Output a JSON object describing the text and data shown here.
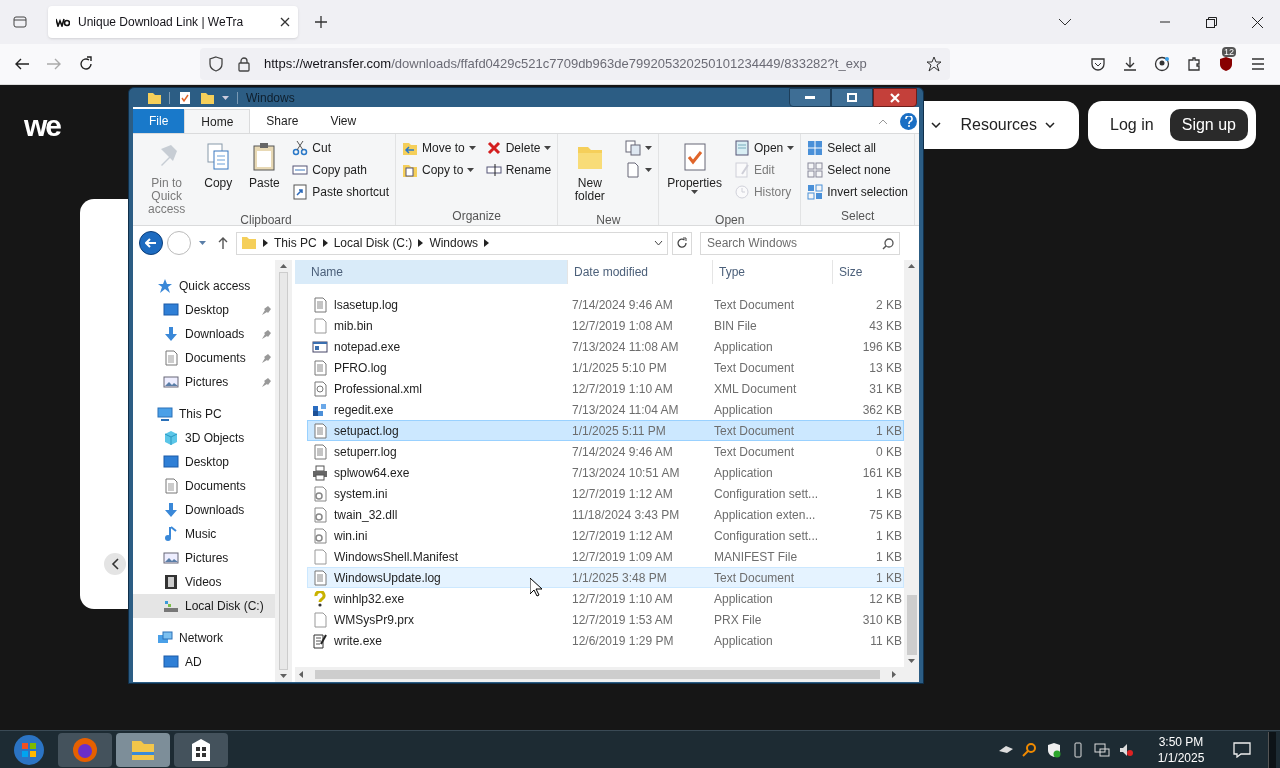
{
  "browser": {
    "tabs": [
      {
        "title": "Unique Download Link | WeTra",
        "selected": true
      }
    ],
    "address": {
      "host": "https://wetransfer.com",
      "path": "/downloads/ffafd0429c521c7709db963de799205320250101234449/833282?t_exp"
    },
    "extension_badge": "12"
  },
  "website": {
    "logo": "we",
    "menus": [
      {
        "label": "Resources"
      }
    ],
    "login": "Log in",
    "signup": "Sign up"
  },
  "explorer": {
    "title": "Windows",
    "ribbon_tabs": [
      {
        "label": "File",
        "kind": "file",
        "selected": false
      },
      {
        "label": "Home",
        "kind": "tab",
        "selected": true
      },
      {
        "label": "Share",
        "kind": "tab",
        "selected": false
      },
      {
        "label": "View",
        "kind": "tab",
        "selected": false
      }
    ],
    "groups": [
      {
        "label": "Clipboard",
        "columns": [
          [
            {
              "label": "Pin to Quick access",
              "kind": "pin",
              "large": true,
              "disabled": true
            }
          ],
          [
            {
              "label": "Copy",
              "kind": "copy",
              "large": true,
              "disabled": false
            }
          ],
          [
            {
              "label": "Paste",
              "kind": "paste",
              "large": true,
              "disabled": false
            }
          ],
          [
            {
              "label": "Cut",
              "kind": "cut",
              "large": false,
              "disabled": false
            },
            {
              "label": "Copy path",
              "kind": "path",
              "large": false,
              "disabled": false
            },
            {
              "label": "Paste shortcut",
              "kind": "shortcut",
              "large": false,
              "disabled": false
            }
          ]
        ]
      },
      {
        "label": "Organize",
        "columns": [
          [
            {
              "label": "Move to",
              "kind": "move",
              "large": false,
              "disabled": false,
              "dropdown": true
            },
            {
              "label": "Copy to",
              "kind": "copyto",
              "large": false,
              "disabled": false,
              "dropdown": true
            }
          ],
          [
            {
              "label": "Delete",
              "kind": "delete",
              "large": false,
              "disabled": false,
              "dropdown": true
            },
            {
              "label": "Rename",
              "kind": "rename",
              "large": false,
              "disabled": false
            }
          ]
        ]
      },
      {
        "label": "New",
        "columns": [
          [
            {
              "label": "New folder",
              "kind": "folder",
              "large": true,
              "disabled": false
            }
          ],
          [
            {
              "kind": "newitem",
              "large": false,
              "disabled": false,
              "dropdown": true
            },
            {
              "kind": "easyaccess",
              "large": false,
              "disabled": false,
              "dropdown": true
            }
          ]
        ]
      },
      {
        "label": "Open",
        "columns": [
          [
            {
              "label": "Properties",
              "kind": "properties",
              "large": true,
              "disabled": false,
              "dropdown": true
            }
          ],
          [
            {
              "label": "Open",
              "kind": "open",
              "large": false,
              "disabled": false,
              "dropdown": true
            },
            {
              "label": "Edit",
              "kind": "edit",
              "large": false,
              "disabled": true
            },
            {
              "label": "History",
              "kind": "history",
              "large": false,
              "disabled": true
            }
          ]
        ]
      },
      {
        "label": "Select",
        "columns": [
          [
            {
              "label": "Select all",
              "kind": "selectall",
              "large": false,
              "disabled": false
            },
            {
              "label": "Select none",
              "kind": "selectnone",
              "large": false,
              "disabled": false
            },
            {
              "label": "Invert selection",
              "kind": "invert",
              "large": false,
              "disabled": false
            }
          ]
        ]
      }
    ],
    "breadcrumbs": [
      "This PC",
      "Local Disk (C:)",
      "Windows"
    ],
    "search": {
      "placeholder": "Search Windows"
    },
    "nav": [
      {
        "label": "Quick access",
        "kind": "star",
        "selected": false,
        "children": [
          {
            "label": "Desktop",
            "kind": "desktop",
            "selected": false,
            "pinned": true
          },
          {
            "label": "Downloads",
            "kind": "downloads",
            "selected": false,
            "pinned": true
          },
          {
            "label": "Documents",
            "kind": "documents",
            "selected": false,
            "pinned": true
          },
          {
            "label": "Pictures",
            "kind": "pictures",
            "selected": false,
            "pinned": true
          }
        ]
      },
      {
        "label": "This PC",
        "kind": "pc",
        "selected": false,
        "children": [
          {
            "label": "3D Objects",
            "kind": "cube",
            "selected": false,
            "pinned": false
          },
          {
            "label": "Desktop",
            "kind": "desktop",
            "selected": false,
            "pinned": false
          },
          {
            "label": "Documents",
            "kind": "documents",
            "selected": false,
            "pinned": false
          },
          {
            "label": "Downloads",
            "kind": "downloads",
            "selected": false,
            "pinned": false
          },
          {
            "label": "Music",
            "kind": "music",
            "selected": false,
            "pinned": false
          },
          {
            "label": "Pictures",
            "kind": "pictures",
            "selected": false,
            "pinned": false
          },
          {
            "label": "Videos",
            "kind": "videos",
            "selected": false,
            "pinned": false
          },
          {
            "label": "Local Disk (C:)",
            "kind": "disk",
            "selected": true,
            "pinned": false
          }
        ]
      },
      {
        "label": "Network",
        "kind": "network",
        "selected": false,
        "children": [
          {
            "label": "AD",
            "kind": "desktop",
            "selected": false,
            "pinned": false
          }
        ]
      }
    ],
    "columns": [
      "Name",
      "Date modified",
      "Type",
      "Size"
    ],
    "files": [
      {
        "name": "lsasetup.log",
        "date": "7/14/2024 9:46 AM",
        "type": "Text Document",
        "size": "2 KB",
        "kind": "text",
        "selected": false,
        "hovered": false
      },
      {
        "name": "mib.bin",
        "date": "12/7/2019 1:08 AM",
        "type": "BIN File",
        "size": "43 KB",
        "kind": "blank",
        "selected": false,
        "hovered": false
      },
      {
        "name": "notepad.exe",
        "date": "7/13/2024 11:08 AM",
        "type": "Application",
        "size": "196 KB",
        "kind": "app",
        "selected": false,
        "hovered": false
      },
      {
        "name": "PFRO.log",
        "date": "1/1/2025 5:10 PM",
        "type": "Text Document",
        "size": "13 KB",
        "kind": "text",
        "selected": false,
        "hovered": false
      },
      {
        "name": "Professional.xml",
        "date": "12/7/2019 1:10 AM",
        "type": "XML Document",
        "size": "31 KB",
        "kind": "xml",
        "selected": false,
        "hovered": false
      },
      {
        "name": "regedit.exe",
        "date": "7/13/2024 11:04 AM",
        "type": "Application",
        "size": "362 KB",
        "kind": "regedit",
        "selected": false,
        "hovered": false
      },
      {
        "name": "setupact.log",
        "date": "1/1/2025 5:11 PM",
        "type": "Text Document",
        "size": "1 KB",
        "kind": "text",
        "selected": true,
        "hovered": false
      },
      {
        "name": "setuperr.log",
        "date": "7/14/2024 9:46 AM",
        "type": "Text Document",
        "size": "0 KB",
        "kind": "text",
        "selected": false,
        "hovered": false
      },
      {
        "name": "splwow64.exe",
        "date": "7/13/2024 10:51 AM",
        "type": "Application",
        "size": "161 KB",
        "kind": "printer",
        "selected": false,
        "hovered": false
      },
      {
        "name": "system.ini",
        "date": "12/7/2019 1:12 AM",
        "type": "Configuration sett...",
        "size": "1 KB",
        "kind": "config",
        "selected": false,
        "hovered": false
      },
      {
        "name": "twain_32.dll",
        "date": "11/18/2024 3:43 PM",
        "type": "Application exten...",
        "size": "75 KB",
        "kind": "config",
        "selected": false,
        "hovered": false
      },
      {
        "name": "win.ini",
        "date": "12/7/2019 1:12 AM",
        "type": "Configuration sett...",
        "size": "1 KB",
        "kind": "config",
        "selected": false,
        "hovered": false
      },
      {
        "name": "WindowsShell.Manifest",
        "date": "12/7/2019 1:09 AM",
        "type": "MANIFEST File",
        "size": "1 KB",
        "kind": "blank",
        "selected": false,
        "hovered": false
      },
      {
        "name": "WindowsUpdate.log",
        "date": "1/1/2025 3:48 PM",
        "type": "Text Document",
        "size": "1 KB",
        "kind": "text",
        "selected": false,
        "hovered": true
      },
      {
        "name": "winhlp32.exe",
        "date": "12/7/2019 1:10 AM",
        "type": "Application",
        "size": "12 KB",
        "kind": "help",
        "selected": false,
        "hovered": false
      },
      {
        "name": "WMSysPr9.prx",
        "date": "12/7/2019 1:53 AM",
        "type": "PRX File",
        "size": "310 KB",
        "kind": "blank",
        "selected": false,
        "hovered": false
      },
      {
        "name": "write.exe",
        "date": "12/6/2019 1:29 PM",
        "type": "Application",
        "size": "11 KB",
        "kind": "write",
        "selected": false,
        "hovered": false
      }
    ]
  },
  "taskbar": {
    "time": "3:50 PM",
    "date": "1/1/2025"
  }
}
